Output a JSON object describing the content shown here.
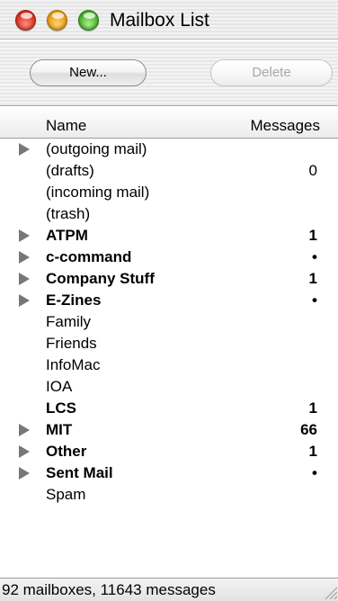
{
  "window": {
    "title": "Mailbox List"
  },
  "toolbar": {
    "new_label": "New...",
    "delete_label": "Delete"
  },
  "columns": {
    "name": "Name",
    "messages": "Messages"
  },
  "mailboxes": [
    {
      "name": "(outgoing mail)",
      "count": "",
      "bold": false,
      "expandable": true
    },
    {
      "name": "(drafts)",
      "count": "0",
      "bold": false,
      "expandable": false
    },
    {
      "name": "(incoming mail)",
      "count": "",
      "bold": false,
      "expandable": false
    },
    {
      "name": "(trash)",
      "count": "",
      "bold": false,
      "expandable": false
    },
    {
      "name": "ATPM",
      "count": "1",
      "bold": true,
      "expandable": true
    },
    {
      "name": "c-command",
      "count": "•",
      "bold": true,
      "expandable": true
    },
    {
      "name": "Company Stuff",
      "count": "1",
      "bold": true,
      "expandable": true
    },
    {
      "name": "E-Zines",
      "count": "•",
      "bold": true,
      "expandable": true
    },
    {
      "name": "Family",
      "count": "",
      "bold": false,
      "expandable": false
    },
    {
      "name": "Friends",
      "count": "",
      "bold": false,
      "expandable": false
    },
    {
      "name": "InfoMac",
      "count": "",
      "bold": false,
      "expandable": false
    },
    {
      "name": "IOA",
      "count": "",
      "bold": false,
      "expandable": false
    },
    {
      "name": "LCS",
      "count": "1",
      "bold": true,
      "expandable": false
    },
    {
      "name": "MIT",
      "count": "66",
      "bold": true,
      "expandable": true
    },
    {
      "name": "Other",
      "count": "1",
      "bold": true,
      "expandable": true
    },
    {
      "name": "Sent Mail",
      "count": "•",
      "bold": true,
      "expandable": true
    },
    {
      "name": "Spam",
      "count": "",
      "bold": false,
      "expandable": false
    }
  ],
  "status": {
    "text": "92 mailboxes, 11643 messages"
  },
  "colors": {
    "close": "#d8291b",
    "minimize": "#e79a0c",
    "zoom": "#3fae1f",
    "disclosure": "#777777"
  }
}
